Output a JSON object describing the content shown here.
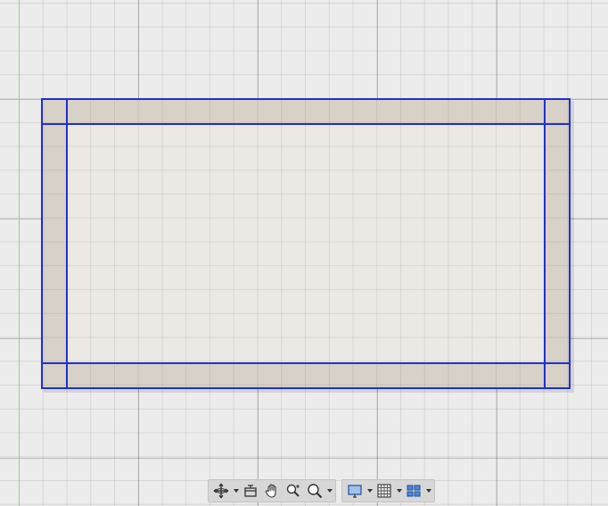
{
  "viewport": {
    "name": "floor-plan-viewport",
    "background_color": "#ececec",
    "grid_color": "#d5d5d5",
    "origin_axis_color": "#7fdc7f",
    "selection_color": "#1f2fd0",
    "wall_fill_color": "#d8d1c7",
    "room_fill_color": "#ece9e4"
  },
  "toolbar": {
    "groups": [
      {
        "name": "navigation-tools",
        "tools": [
          {
            "id": "orbit",
            "icon": "orbit-icon",
            "has_dropdown": true
          },
          {
            "id": "look-at",
            "icon": "look-at-icon",
            "has_dropdown": false
          },
          {
            "id": "pan",
            "icon": "pan-hand-icon",
            "has_dropdown": false
          },
          {
            "id": "zoom-realtime",
            "icon": "zoom-realtime-icon",
            "has_dropdown": false
          },
          {
            "id": "zoom-window",
            "icon": "zoom-window-icon",
            "has_dropdown": true
          }
        ]
      },
      {
        "name": "display-tools",
        "tools": [
          {
            "id": "display-mode",
            "icon": "monitor-icon",
            "has_dropdown": true
          },
          {
            "id": "grid",
            "icon": "grid-icon",
            "has_dropdown": true
          },
          {
            "id": "viewports",
            "icon": "viewport-layout-icon",
            "has_dropdown": true
          }
        ]
      }
    ]
  }
}
